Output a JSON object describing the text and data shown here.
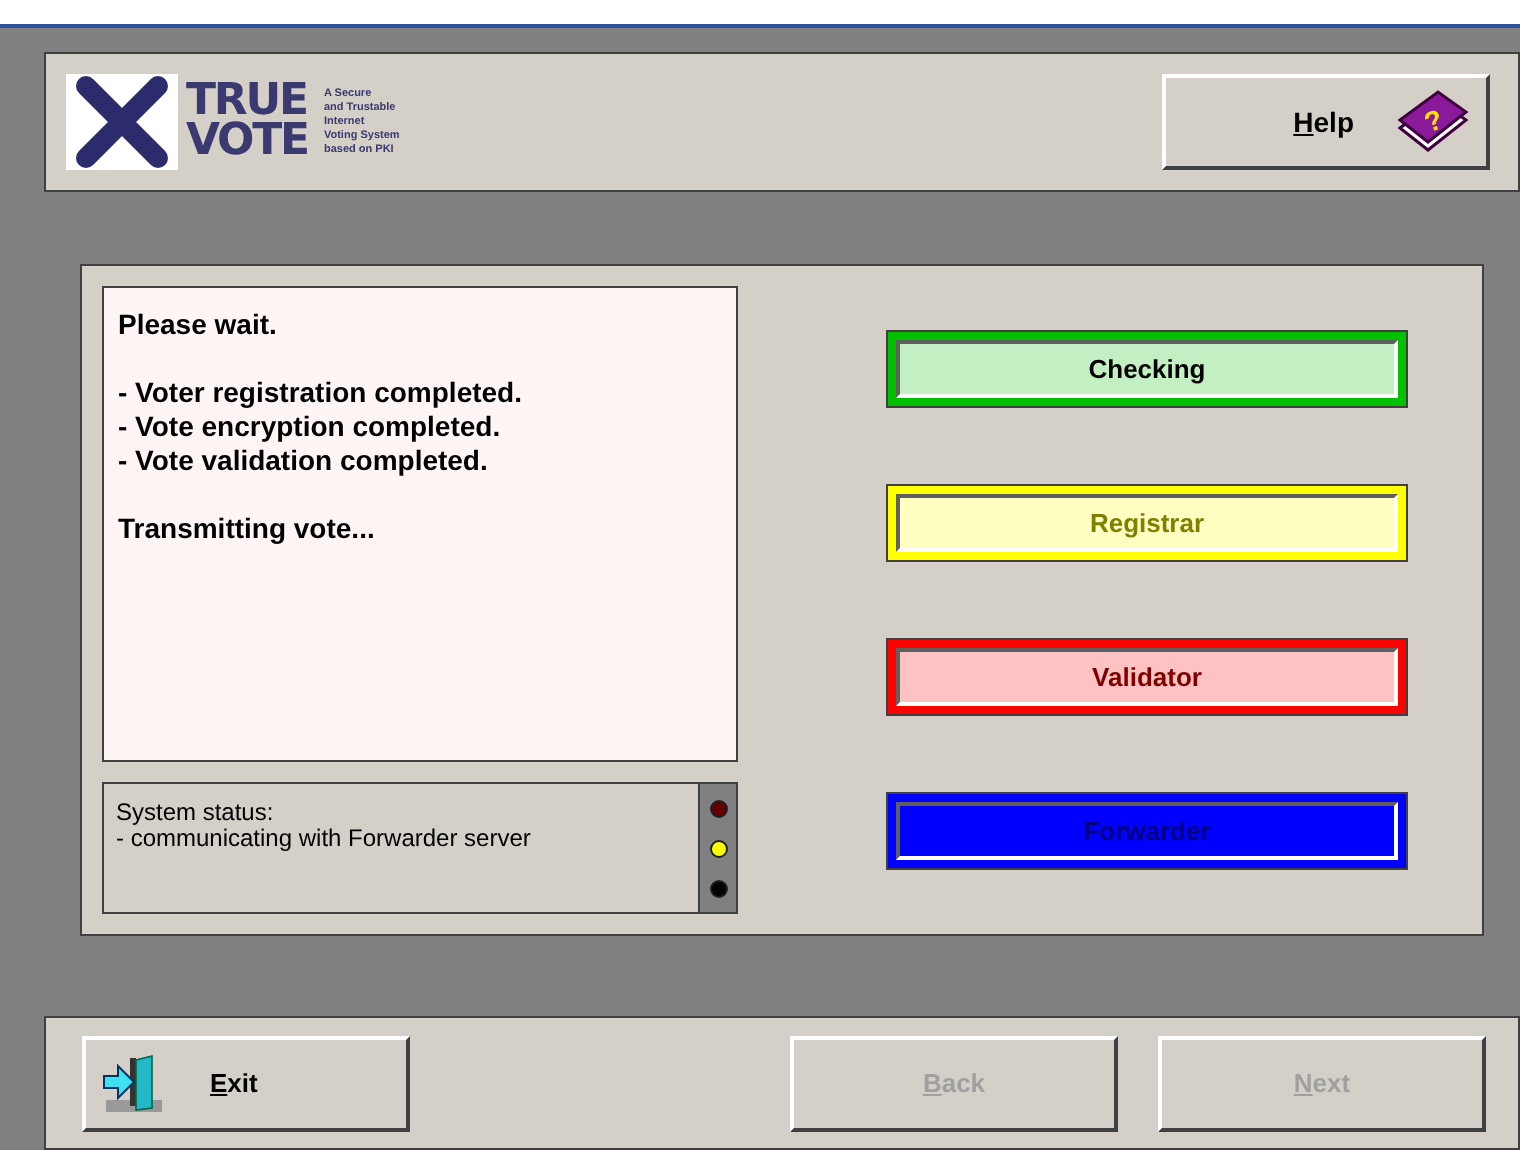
{
  "logo": {
    "word_1": "TRUE",
    "word_2": "VOTE",
    "tagline": [
      "A Secure",
      "and Trustable",
      "Internet",
      "Voting System",
      "based on PKI"
    ]
  },
  "help_button": {
    "label": "Help",
    "underline_first": true,
    "icon_glyph": "?"
  },
  "message": {
    "paragraphs": [
      [
        "Please wait."
      ],
      [
        "- Voter registration completed.",
        "- Vote encryption completed.",
        "- Vote validation completed."
      ],
      [
        "Transmitting vote..."
      ]
    ]
  },
  "system_status": {
    "title": "System status:",
    "detail": "- communicating with Forwarder server",
    "lights": [
      {
        "color": "#600000"
      },
      {
        "color": "#ffff00"
      },
      {
        "color": "#000000"
      }
    ]
  },
  "servers": [
    {
      "label": "Checking",
      "color": "#00c000",
      "kind": "done"
    },
    {
      "label": "Registrar",
      "color": "#ffff00",
      "kind": "pending"
    },
    {
      "label": "Validator",
      "color": "#ff0000",
      "kind": "pending"
    },
    {
      "label": "Forwarder",
      "color": "#0000ff",
      "kind": "active"
    }
  ],
  "footer_buttons": [
    {
      "label": "Exit",
      "disabled": false,
      "underline_first": true,
      "kind": "exit"
    },
    {
      "label": "Back",
      "disabled": true,
      "underline_first": true,
      "kind": "plain"
    },
    {
      "label": "Next",
      "disabled": true,
      "underline_first": true,
      "kind": "plain"
    }
  ]
}
